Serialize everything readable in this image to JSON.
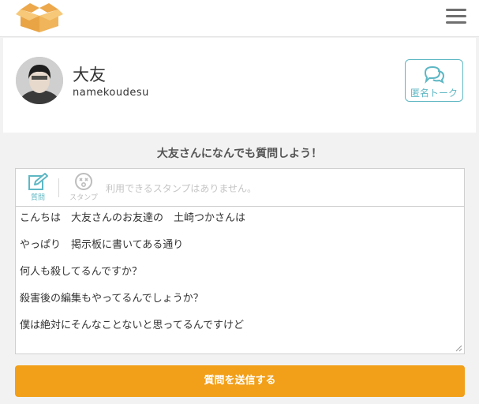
{
  "header": {
    "logo_icon": "open-box-icon",
    "menu_icon": "hamburger-menu-icon"
  },
  "profile": {
    "name": "大友",
    "username": "namekoudesu",
    "anon_talk_label": "匿名トーク",
    "anon_talk_icon": "chat-bubbles-icon"
  },
  "prompt": "大友さんになんでも質問しよう！",
  "form": {
    "toolbar": {
      "question_label": "質問",
      "question_icon": "edit-icon",
      "stamp_label": "スタンプ",
      "stamp_icon": "face-icon",
      "stamp_message": "利用できるスタンプはありません。"
    },
    "lines": [
      "こんちは　大友さんのお友達の　土崎つかさんは",
      "やっぱり　掲示板に書いてある通り",
      "何人も殺してるんですか？",
      "殺害後の編集もやってるんでしょうか？",
      "僕は絶対にそんなことないと思ってるんですけど"
    ]
  },
  "submit_label": "質問を送信する",
  "colors": {
    "accent_teal": "#5eb7c4",
    "submit_orange": "#f29f19",
    "logo_orange": "#f0b45a"
  }
}
